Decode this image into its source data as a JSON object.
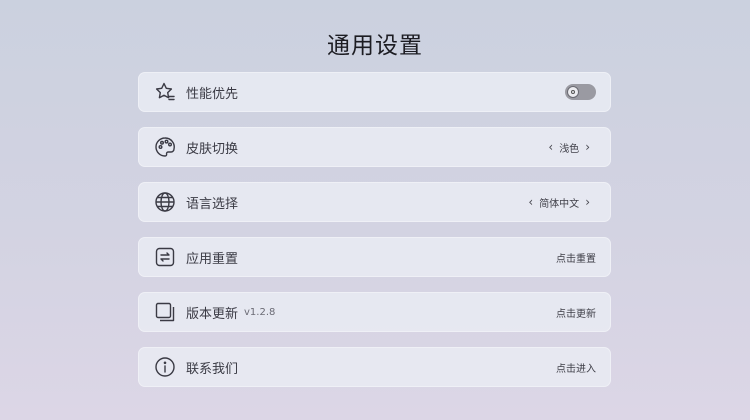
{
  "page": {
    "title": "通用设置"
  },
  "settings": [
    {
      "icon": "star-icon",
      "label": "性能优先",
      "toggle_on": false
    },
    {
      "icon": "palette-icon",
      "label": "皮肤切换",
      "value": "浅色"
    },
    {
      "icon": "globe-icon",
      "label": "语言选择",
      "value": "简体中文"
    },
    {
      "icon": "reset-icon",
      "label": "应用重置",
      "action": "点击重置"
    },
    {
      "icon": "copy-icon",
      "label": "版本更新",
      "version": "v1.2.8",
      "action": "点击更新"
    },
    {
      "icon": "info-icon",
      "label": "联系我们",
      "action": "点击进入"
    }
  ],
  "selector": {
    "prev": "‹",
    "next": "›"
  }
}
